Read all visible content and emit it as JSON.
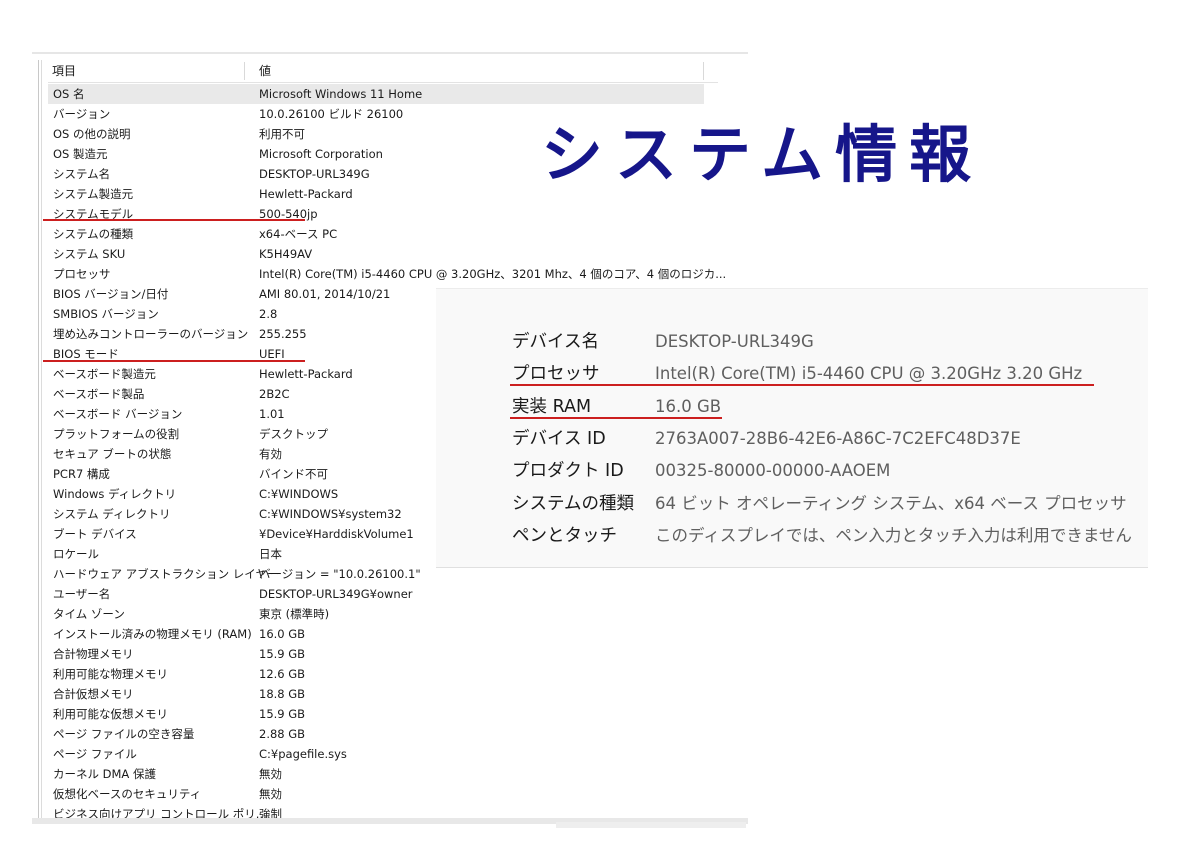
{
  "title": "システム情報",
  "sysinfo": {
    "col_item": "項目",
    "col_value": "値",
    "rows": [
      {
        "key": "OS 名",
        "value": "Microsoft Windows 11 Home"
      },
      {
        "key": "バージョン",
        "value": "10.0.26100 ビルド 26100"
      },
      {
        "key": "OS の他の説明",
        "value": "利用不可"
      },
      {
        "key": "OS 製造元",
        "value": "Microsoft Corporation"
      },
      {
        "key": "システム名",
        "value": "DESKTOP-URL349G"
      },
      {
        "key": "システム製造元",
        "value": "Hewlett-Packard"
      },
      {
        "key": "システムモデル",
        "value": "500-540jp"
      },
      {
        "key": "システムの種類",
        "value": "x64-ベース PC"
      },
      {
        "key": "システム SKU",
        "value": "K5H49AV"
      },
      {
        "key": "プロセッサ",
        "value": "Intel(R) Core(TM) i5-4460  CPU @ 3.20GHz、3201 Mhz、4 個のコア、4 個のロジカ..."
      },
      {
        "key": "BIOS バージョン/日付",
        "value": "AMI 80.01, 2014/10/21"
      },
      {
        "key": "SMBIOS バージョン",
        "value": "2.8"
      },
      {
        "key": "埋め込みコントローラーのバージョン",
        "value": "255.255"
      },
      {
        "key": "BIOS モード",
        "value": "UEFI"
      },
      {
        "key": "ベースボード製造元",
        "value": "Hewlett-Packard"
      },
      {
        "key": "ベースボード製品",
        "value": "2B2C"
      },
      {
        "key": "ベースボード バージョン",
        "value": "1.01"
      },
      {
        "key": "プラットフォームの役割",
        "value": "デスクトップ"
      },
      {
        "key": "セキュア ブートの状態",
        "value": "有効"
      },
      {
        "key": "PCR7 構成",
        "value": "バインド不可"
      },
      {
        "key": "Windows ディレクトリ",
        "value": "C:¥WINDOWS"
      },
      {
        "key": "システム ディレクトリ",
        "value": "C:¥WINDOWS¥system32"
      },
      {
        "key": "ブート デバイス",
        "value": "¥Device¥HarddiskVolume1"
      },
      {
        "key": "ロケール",
        "value": "日本"
      },
      {
        "key": "ハードウェア アブストラクション レイヤー",
        "value": "バージョン = \"10.0.26100.1\""
      },
      {
        "key": "ユーザー名",
        "value": "DESKTOP-URL349G¥owner"
      },
      {
        "key": "タイム ゾーン",
        "value": "東京 (標準時)"
      },
      {
        "key": "インストール済みの物理メモリ (RAM)",
        "value": "16.0 GB"
      },
      {
        "key": "合計物理メモリ",
        "value": "15.9 GB"
      },
      {
        "key": "利用可能な物理メモリ",
        "value": "12.6 GB"
      },
      {
        "key": "合計仮想メモリ",
        "value": "18.8 GB"
      },
      {
        "key": "利用可能な仮想メモリ",
        "value": "15.9 GB"
      },
      {
        "key": "ページ ファイルの空き容量",
        "value": "2.88 GB"
      },
      {
        "key": "ページ ファイル",
        "value": "C:¥pagefile.sys"
      },
      {
        "key": "カーネル DMA 保護",
        "value": "無効"
      },
      {
        "key": "仮想化ベースのセキュリティ",
        "value": "無効"
      },
      {
        "key": "ビジネス向けアプリ コントロール ポリ...",
        "value": "強制"
      }
    ]
  },
  "device_specs": [
    {
      "label": "デバイス名",
      "value": "DESKTOP-URL349G"
    },
    {
      "label": "プロセッサ",
      "value": "Intel(R) Core(TM) i5-4460  CPU @ 3.20GHz   3.20 GHz"
    },
    {
      "label": "実装 RAM",
      "value": "16.0 GB"
    },
    {
      "label": "デバイス ID",
      "value": "2763A007-28B6-42E6-A86C-7C2EFC48D37E"
    },
    {
      "label": "プロダクト ID",
      "value": "00325-80000-00000-AAOEM"
    },
    {
      "label": "システムの種類",
      "value": "64 ビット オペレーティング システム、x64 ベース プロセッサ"
    },
    {
      "label": "ペンとタッチ",
      "value": "このディスプレイでは、ペン入力とタッチ入力は利用できません"
    }
  ],
  "colors": {
    "title": "#16168a",
    "highlight": "#cc1f1f",
    "selected_row": "#e9e9e9"
  }
}
